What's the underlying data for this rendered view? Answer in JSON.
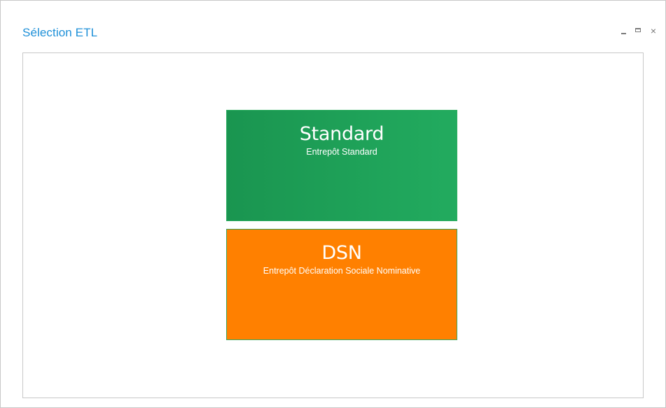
{
  "window": {
    "title": "Sélection ETL",
    "controls": {
      "minimize_icon": "minimize-icon",
      "maximize_icon": "maximize-icon",
      "close_icon": "close-icon",
      "close_glyph": "×"
    }
  },
  "tiles": [
    {
      "title": "Standard",
      "subtitle": "Entrepôt Standard",
      "color": "#1e9d55"
    },
    {
      "title": "DSN",
      "subtitle": "Entrepôt Déclaration Sociale Nominative",
      "color": "#ff8000"
    }
  ],
  "colors": {
    "title": "#1e90d8",
    "border": "#c8c8c8"
  }
}
